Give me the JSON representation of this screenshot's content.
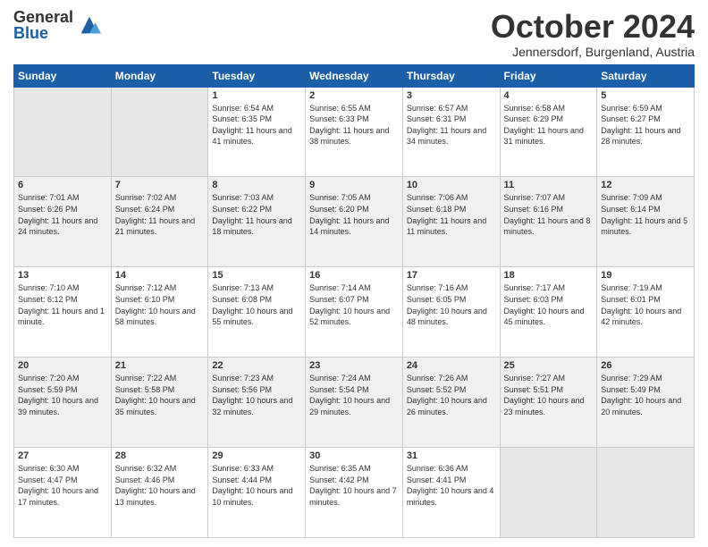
{
  "logo": {
    "general": "General",
    "blue": "Blue"
  },
  "header": {
    "month": "October 2024",
    "location": "Jennersdorf, Burgenland, Austria"
  },
  "days_of_week": [
    "Sunday",
    "Monday",
    "Tuesday",
    "Wednesday",
    "Thursday",
    "Friday",
    "Saturday"
  ],
  "weeks": [
    [
      {
        "day": "",
        "info": ""
      },
      {
        "day": "",
        "info": ""
      },
      {
        "day": "1",
        "info": "Sunrise: 6:54 AM\nSunset: 6:35 PM\nDaylight: 11 hours and 41 minutes."
      },
      {
        "day": "2",
        "info": "Sunrise: 6:55 AM\nSunset: 6:33 PM\nDaylight: 11 hours and 38 minutes."
      },
      {
        "day": "3",
        "info": "Sunrise: 6:57 AM\nSunset: 6:31 PM\nDaylight: 11 hours and 34 minutes."
      },
      {
        "day": "4",
        "info": "Sunrise: 6:58 AM\nSunset: 6:29 PM\nDaylight: 11 hours and 31 minutes."
      },
      {
        "day": "5",
        "info": "Sunrise: 6:59 AM\nSunset: 6:27 PM\nDaylight: 11 hours and 28 minutes."
      }
    ],
    [
      {
        "day": "6",
        "info": "Sunrise: 7:01 AM\nSunset: 6:26 PM\nDaylight: 11 hours and 24 minutes."
      },
      {
        "day": "7",
        "info": "Sunrise: 7:02 AM\nSunset: 6:24 PM\nDaylight: 11 hours and 21 minutes."
      },
      {
        "day": "8",
        "info": "Sunrise: 7:03 AM\nSunset: 6:22 PM\nDaylight: 11 hours and 18 minutes."
      },
      {
        "day": "9",
        "info": "Sunrise: 7:05 AM\nSunset: 6:20 PM\nDaylight: 11 hours and 14 minutes."
      },
      {
        "day": "10",
        "info": "Sunrise: 7:06 AM\nSunset: 6:18 PM\nDaylight: 11 hours and 11 minutes."
      },
      {
        "day": "11",
        "info": "Sunrise: 7:07 AM\nSunset: 6:16 PM\nDaylight: 11 hours and 8 minutes."
      },
      {
        "day": "12",
        "info": "Sunrise: 7:09 AM\nSunset: 6:14 PM\nDaylight: 11 hours and 5 minutes."
      }
    ],
    [
      {
        "day": "13",
        "info": "Sunrise: 7:10 AM\nSunset: 6:12 PM\nDaylight: 11 hours and 1 minute."
      },
      {
        "day": "14",
        "info": "Sunrise: 7:12 AM\nSunset: 6:10 PM\nDaylight: 10 hours and 58 minutes."
      },
      {
        "day": "15",
        "info": "Sunrise: 7:13 AM\nSunset: 6:08 PM\nDaylight: 10 hours and 55 minutes."
      },
      {
        "day": "16",
        "info": "Sunrise: 7:14 AM\nSunset: 6:07 PM\nDaylight: 10 hours and 52 minutes."
      },
      {
        "day": "17",
        "info": "Sunrise: 7:16 AM\nSunset: 6:05 PM\nDaylight: 10 hours and 48 minutes."
      },
      {
        "day": "18",
        "info": "Sunrise: 7:17 AM\nSunset: 6:03 PM\nDaylight: 10 hours and 45 minutes."
      },
      {
        "day": "19",
        "info": "Sunrise: 7:19 AM\nSunset: 6:01 PM\nDaylight: 10 hours and 42 minutes."
      }
    ],
    [
      {
        "day": "20",
        "info": "Sunrise: 7:20 AM\nSunset: 5:59 PM\nDaylight: 10 hours and 39 minutes."
      },
      {
        "day": "21",
        "info": "Sunrise: 7:22 AM\nSunset: 5:58 PM\nDaylight: 10 hours and 35 minutes."
      },
      {
        "day": "22",
        "info": "Sunrise: 7:23 AM\nSunset: 5:56 PM\nDaylight: 10 hours and 32 minutes."
      },
      {
        "day": "23",
        "info": "Sunrise: 7:24 AM\nSunset: 5:54 PM\nDaylight: 10 hours and 29 minutes."
      },
      {
        "day": "24",
        "info": "Sunrise: 7:26 AM\nSunset: 5:52 PM\nDaylight: 10 hours and 26 minutes."
      },
      {
        "day": "25",
        "info": "Sunrise: 7:27 AM\nSunset: 5:51 PM\nDaylight: 10 hours and 23 minutes."
      },
      {
        "day": "26",
        "info": "Sunrise: 7:29 AM\nSunset: 5:49 PM\nDaylight: 10 hours and 20 minutes."
      }
    ],
    [
      {
        "day": "27",
        "info": "Sunrise: 6:30 AM\nSunset: 4:47 PM\nDaylight: 10 hours and 17 minutes."
      },
      {
        "day": "28",
        "info": "Sunrise: 6:32 AM\nSunset: 4:46 PM\nDaylight: 10 hours and 13 minutes."
      },
      {
        "day": "29",
        "info": "Sunrise: 6:33 AM\nSunset: 4:44 PM\nDaylight: 10 hours and 10 minutes."
      },
      {
        "day": "30",
        "info": "Sunrise: 6:35 AM\nSunset: 4:42 PM\nDaylight: 10 hours and 7 minutes."
      },
      {
        "day": "31",
        "info": "Sunrise: 6:36 AM\nSunset: 4:41 PM\nDaylight: 10 hours and 4 minutes."
      },
      {
        "day": "",
        "info": ""
      },
      {
        "day": "",
        "info": ""
      }
    ]
  ]
}
